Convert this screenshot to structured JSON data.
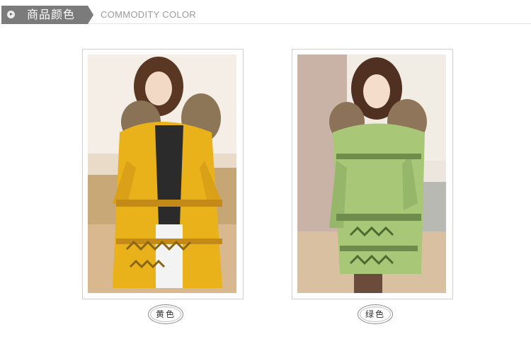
{
  "header": {
    "title_cn": "商品颜色",
    "title_en": "COMMODITY COLOR",
    "icon": "play-bullet-icon"
  },
  "products": [
    {
      "label": "黄色",
      "coat_color": "#e9b21b",
      "image_desc_icon": "model-photo"
    },
    {
      "label": "绿色",
      "coat_color": "#a8c777",
      "image_desc_icon": "model-photo"
    }
  ],
  "colors": {
    "header_tab_bg": "#7b7b7b",
    "header_rule": "#e3e3e3",
    "en_text": "#9a9a9a"
  }
}
